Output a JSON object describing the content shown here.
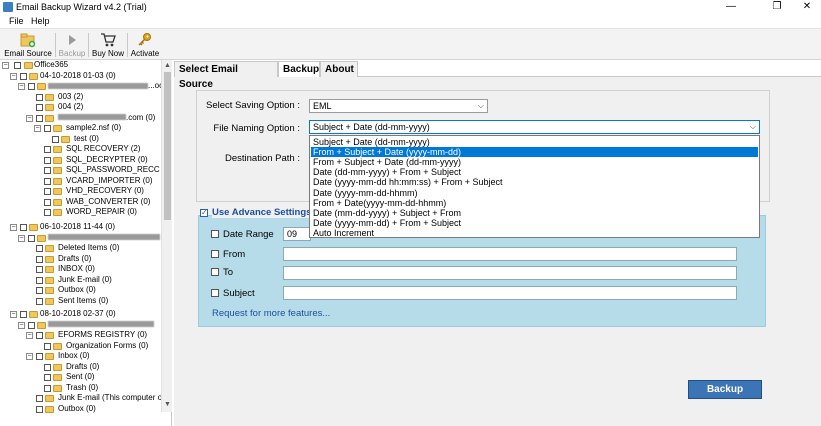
{
  "window": {
    "title": "Email Backup Wizard v4.2 (Trial)",
    "minimize": "—",
    "maximize": "❐",
    "close": "✕"
  },
  "menu": [
    "File",
    "Help"
  ],
  "toolbar": {
    "email_source": "Email Source",
    "backup": "Backup",
    "buy_now": "Buy Now",
    "activate": "Activate"
  },
  "tree": {
    "root": "Office365",
    "n1": "04-10-2018 01-03 (0)",
    "n1_acc": "...oc",
    "n2": "003 (2)",
    "n3": "004 (2)",
    "n4_suffix": ".com (0)",
    "n5": "sample2.nsf (0)",
    "n6": "test (0)",
    "n7": "SQL RECOVERY (2)",
    "n8": "SQL_DECRYPTER (0)",
    "n9": "SQL_PASSWORD_RECC",
    "n10": "VCARD_IMPORTER (0)",
    "n11": "VHD_RECOVERY (0)",
    "n12": "WAB_CONVERTER (0)",
    "n13": "WORD_REPAIR (0)",
    "n14": "06-10-2018 11-44 (0)",
    "n15": "Deleted Items (0)",
    "n16": "Drafts (0)",
    "n17": "INBOX (0)",
    "n18": "Junk E-mail (0)",
    "n19": "Outbox (0)",
    "n20": "Sent Items (0)",
    "n21": "08-10-2018 02-37 (0)",
    "n22": "EFORMS REGISTRY (0)",
    "n23": "Organization Forms (0)",
    "n24": "Inbox (0)",
    "n25": "Drafts (0)",
    "n26": "Sent (0)",
    "n27": "Trash (0)",
    "n28": "Junk E-mail (This computer o",
    "n29": "Outbox (0)"
  },
  "tabs": [
    "Select Email Source",
    "Backup",
    "About"
  ],
  "form": {
    "saving_option_label": "Select Saving Option :",
    "saving_option_value": "EML",
    "naming_option_label": "File Naming Option :",
    "naming_option_value": "Subject + Date (dd-mm-yyyy)",
    "destination_label": "Destination Path :"
  },
  "naming_options": [
    "Subject + Date (dd-mm-yyyy)",
    "From + Subject + Date (yyyy-mm-dd)",
    "From + Subject + Date (dd-mm-yyyy)",
    "Date (dd-mm-yyyy) + From + Subject",
    "Date (yyyy-mm-dd hh:mm:ss) + From + Subject",
    "Date (yyyy-mm-dd-hhmm)",
    "From + Date(yyyy-mm-dd-hhmm)",
    "Date (mm-dd-yyyy) + Subject + From",
    "Date (yyyy-mm-dd) + From + Subject",
    "Auto Increment"
  ],
  "selected_option_index": 1,
  "advance": {
    "label": "Use Advance Settings",
    "date_range": "Date Range",
    "date_from_value": "09",
    "from": "From",
    "to": "To",
    "subject": "Subject",
    "request_link": "Request for more features..."
  },
  "backup_button": "Backup",
  "colors": {
    "accent": "#0078d7",
    "advance_bg": "#b7dce9",
    "button_bg": "#3b75b6",
    "link": "#1a4f9c"
  }
}
